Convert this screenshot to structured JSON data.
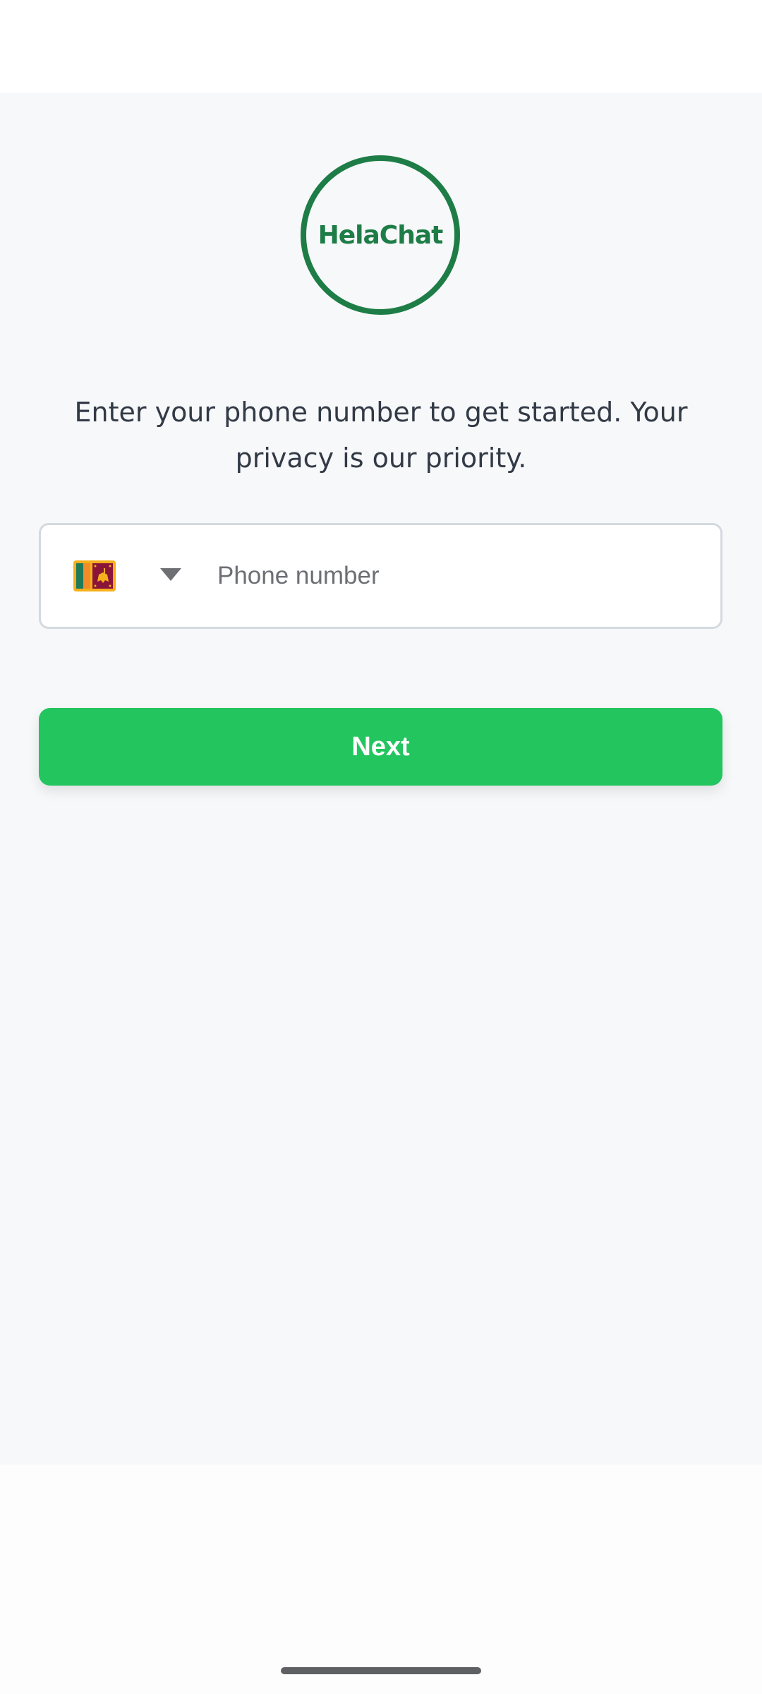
{
  "app": {
    "logo_text": "HelaChat",
    "brand_color": "#1e7d46"
  },
  "intro": {
    "text": "Enter your phone number to get started. Your privacy is our priority."
  },
  "phone": {
    "country_flag_icon": "sri-lanka-flag-icon",
    "dropdown_icon": "caret-down-icon",
    "value": "",
    "placeholder": "Phone number"
  },
  "actions": {
    "next_label": "Next",
    "accent_color": "#23c55e"
  }
}
